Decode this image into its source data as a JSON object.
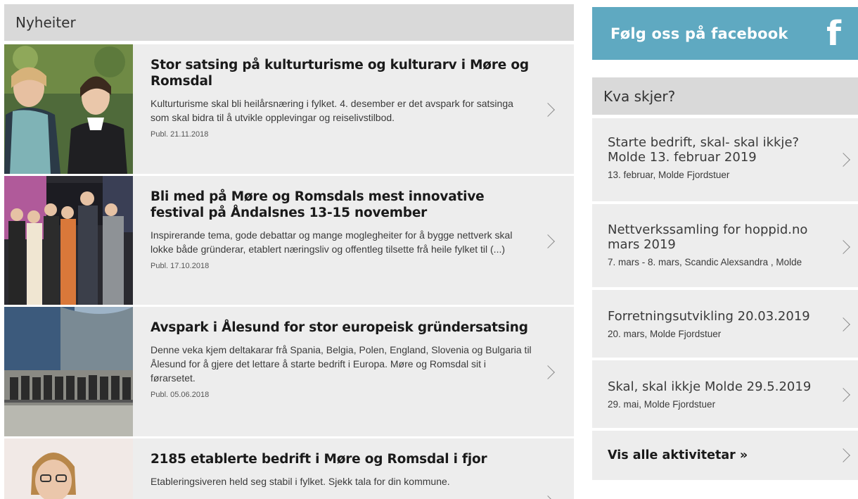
{
  "news": {
    "heading": "Nyheiter",
    "items": [
      {
        "title": "Stor satsing på kulturturisme og kulturarv i Møre og Romsdal",
        "text": "Kulturturisme skal bli heilårsnæring i fylket. 4. desember er det avspark for satsinga som skal bidra til å utvikle opplevingar og reiselivstilbod.",
        "date": "Publ. 21.11.2018"
      },
      {
        "title": "Bli med på Møre og Romsdals mest innovative festival på Åndalsnes 13-15 november",
        "text": "Inspirerande tema, gode debattar og mange moglegheiter for å bygge nettverk skal lokke både gründerar, etablert næringsliv og offentleg tilsette frå heile fylket til (...)",
        "date": "Publ. 17.10.2018"
      },
      {
        "title": "Avspark i Ålesund for stor europeisk gründersatsing",
        "text": "Denne veka kjem deltakarar frå Spania, Belgia, Polen, England, Slovenia og Bulgaria til Ålesund for å gjere det lettare å starte bedrift i Europa. Møre og Romsdal sit i førarsetet.",
        "date": "Publ. 05.06.2018"
      },
      {
        "title": "2185 etablerte bedrift i Møre og Romsdal i fjor",
        "text": "Etableringsiveren held seg stabil i fylket. Sjekk tala for din kommune.",
        "date": ""
      }
    ]
  },
  "facebook": {
    "label": "Følg oss på facebook",
    "logo": "f",
    "color": "#5fa9c1"
  },
  "events": {
    "heading": "Kva skjer?",
    "items": [
      {
        "title": "Starte bedrift, skal- skal ikkje? Molde 13. februar 2019",
        "meta": "13. februar, Molde Fjordstuer"
      },
      {
        "title": "Nettverkssamling for hoppid.no mars 2019",
        "meta": "7. mars - 8. mars, Scandic Alexsandra , Molde"
      },
      {
        "title": "Forretningsutvikling 20.03.2019",
        "meta": "20. mars, Molde Fjordstuer"
      },
      {
        "title": "Skal, skal ikkje Molde 29.5.2019",
        "meta": "29. mai, Molde Fjordstuer"
      }
    ],
    "all_label": "Vis alle aktivitetar »"
  }
}
